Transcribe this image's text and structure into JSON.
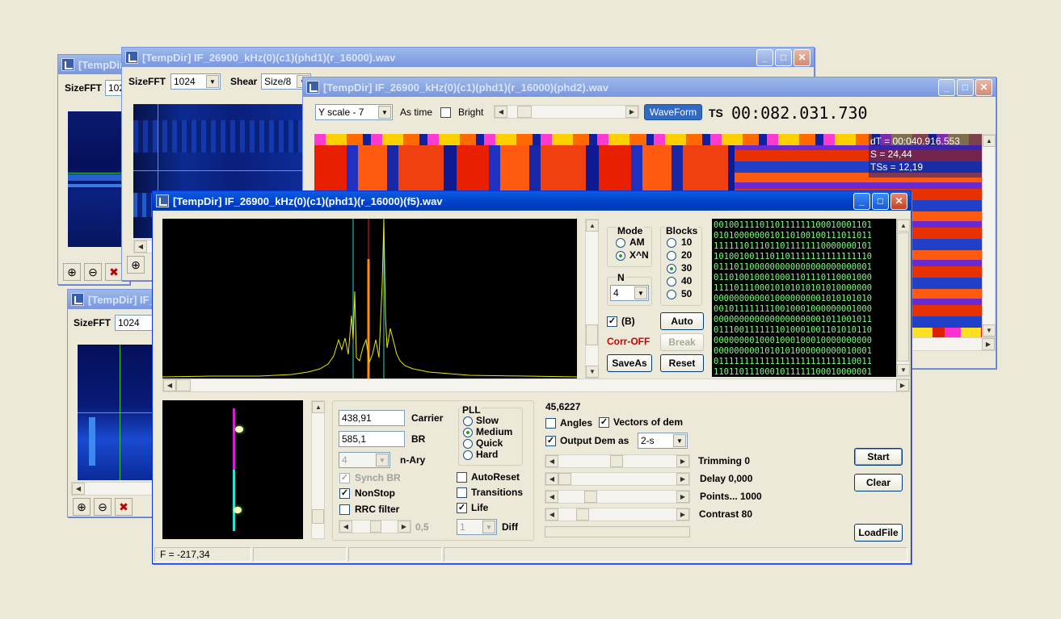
{
  "windows": {
    "w1": {
      "title": "[TempDir] IF_",
      "sizefft_label": "SizeFFT",
      "sizefft_value": "1024"
    },
    "w2": {
      "title": "[TempDir] IF_26900_kHz(0)(c1)(phd1)(r_16000).wav",
      "sizefft_label": "SizeFFT",
      "sizefft_value": "1024",
      "shear_label": "Shear",
      "shear_value": "Size/8"
    },
    "w3": {
      "title": "[TempDir] IF_",
      "sizefft_label": "SizeFFT",
      "sizefft_value": "1024"
    },
    "w4": {
      "title": "[TempDir] IF_26900_kHz(0)(c1)(phd1)(r_16000)(phd2).wav",
      "yscale_value": "Y scale - 7",
      "as_time_label": "As time",
      "bright_label": "Bright",
      "waveform_label": "WaveForm",
      "ts_label": "TS",
      "ts_value": "00:082.031.730",
      "overlay": {
        "dt": "dT = 00:040.916.553",
        "s": "S = 24,44",
        "tss": "TSs = 12,19"
      }
    },
    "main": {
      "title": "[TempDir] IF_26900_kHz(0)(c1)(phd1)(r_16000)(f5).wav",
      "mode": {
        "label": "Mode",
        "options": [
          "AM",
          "X^N"
        ],
        "selected": "X^N"
      },
      "blocks": {
        "label": "Blocks",
        "options": [
          "10",
          "20",
          "30",
          "40",
          "50"
        ],
        "selected": "30"
      },
      "n": {
        "label": "N",
        "value": "4"
      },
      "b_label": "(B)",
      "corr_label": "Corr-OFF",
      "corr_color": "#cc0000",
      "buttons": {
        "auto": "Auto",
        "break": "Break",
        "saveas": "SaveAs",
        "reset": "Reset",
        "start": "Start",
        "clear": "Clear",
        "loadfile": "LoadFile"
      },
      "bits": [
        "0010011110110111111100010001101",
        "0101000000010110100100111011011",
        "1111110111011011111110000000101",
        "1010010011101101111111111111110",
        "0111011000000000000000000000001",
        "0110100100010001101110110001000",
        "1111011100010101010101010000000",
        "0000000000010000000001010101010",
        "0010111111110010001000000001000",
        "0000000000000000000001011001011",
        "0111001111111010001001101010110",
        "0000000010001000100010000000000",
        "0000000001010101000000000010001",
        "0111111111111111111111111110011",
        "1101101110001011111100010000001"
      ],
      "carrier": {
        "value": "438,91",
        "label": "Carrier"
      },
      "br": {
        "value": "585,1",
        "label": "BR"
      },
      "nary": {
        "value": "4",
        "label": "n-Ary"
      },
      "pll": {
        "label": "PLL",
        "options": [
          "Slow",
          "Medium",
          "Quick",
          "Hard"
        ],
        "selected": "Medium"
      },
      "synch_br": "Synch BR",
      "nonstop": "NonStop",
      "rrc": "RRC filter",
      "autoreset": "AutoReset",
      "transitions": "Transitions",
      "life": "Life",
      "slider_value": "0,5",
      "diff": {
        "value": "1",
        "label": "Diff"
      },
      "readout": "45,6227",
      "angles": "Angles",
      "vectors": "Vectors of dem",
      "output_dem": "Output Dem as",
      "output_dem_value": "2-s",
      "trimming": "Trimming 0",
      "delay": "Delay  0,000",
      "points": "Points... 1000",
      "contrast": "Contrast 80",
      "status_f": "F = -217,34"
    }
  },
  "colors": {
    "titlebar": "#0041c8",
    "spectrum_trace": "#e8e800",
    "bits_text": "#7cfc7c",
    "marker_red": "#ff2020",
    "marker_cyan": "#30d0d0"
  }
}
